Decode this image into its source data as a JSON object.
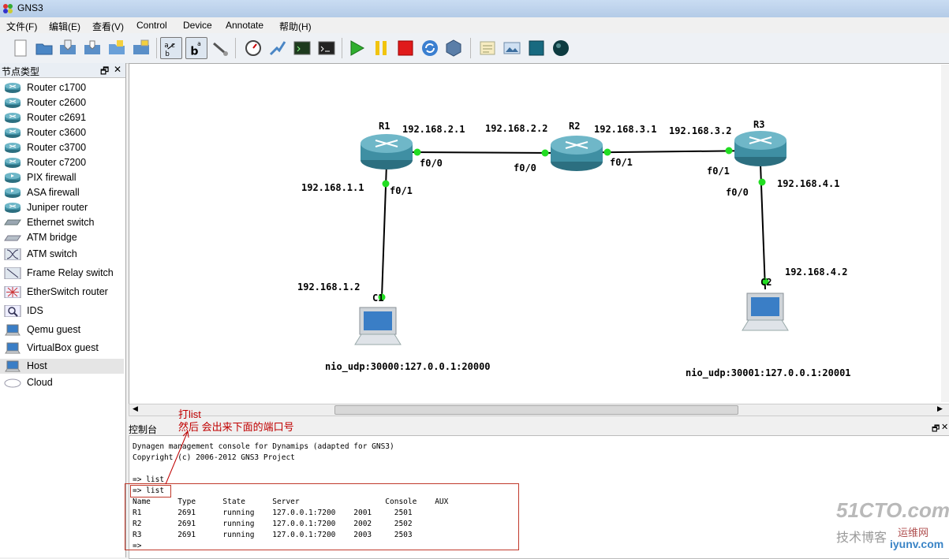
{
  "window": {
    "title": "GNS3"
  },
  "menu": [
    "文件(F)",
    "编辑(E)",
    "查看(V)",
    "Control",
    "Device",
    "Annotate",
    "帮助(H)"
  ],
  "dock": {
    "title": "节点类型",
    "float_icon": "restore-icon",
    "close_icon": "close-icon",
    "nodes": [
      {
        "label": "Router c1700",
        "icon": "router-icon"
      },
      {
        "label": "Router c2600",
        "icon": "router-icon"
      },
      {
        "label": "Router c2691",
        "icon": "router-icon"
      },
      {
        "label": "Router c3600",
        "icon": "router-icon"
      },
      {
        "label": "Router c3700",
        "icon": "router-icon"
      },
      {
        "label": "Router c7200",
        "icon": "router-icon"
      },
      {
        "label": "PIX firewall",
        "icon": "firewall-icon"
      },
      {
        "label": "ASA firewall",
        "icon": "firewall-icon"
      },
      {
        "label": "Juniper router",
        "icon": "router-icon"
      },
      {
        "label": "Ethernet switch",
        "icon": "switch-icon"
      },
      {
        "label": "ATM bridge",
        "icon": "bridge-icon"
      },
      {
        "label": "ATM switch",
        "icon": "atm-switch-icon"
      },
      {
        "label": "Frame Relay switch",
        "icon": "frame-relay-icon"
      },
      {
        "label": "EtherSwitch router",
        "icon": "etherswitch-icon"
      },
      {
        "label": "IDS",
        "icon": "ids-icon"
      },
      {
        "label": "Qemu guest",
        "icon": "computer-icon"
      },
      {
        "label": "VirtualBox guest",
        "icon": "computer-icon"
      },
      {
        "label": "Host",
        "icon": "computer-icon",
        "selected": true
      },
      {
        "label": "Cloud",
        "icon": "cloud-icon"
      }
    ]
  },
  "topology": {
    "devices": {
      "r1": {
        "name": "R1"
      },
      "r2": {
        "name": "R2"
      },
      "r3": {
        "name": "R3"
      },
      "c1": {
        "name": "C1"
      },
      "c2": {
        "name": "C2"
      }
    },
    "labels": {
      "r1_ip_r2": "192.168.2.1",
      "r2_ip_r1": "192.168.2.2",
      "r2_ip_r3": "192.168.3.1",
      "r3_ip_r2": "192.168.3.2",
      "r1_f00": "f0/0",
      "r2_f00": "f0/0",
      "r2_f01": "f0/1",
      "r3_f01": "f0/1",
      "r1_ip_c1": "192.168.1.1",
      "r1_f01": "f0/1",
      "c1_ip": "192.168.1.2",
      "r3_f00": "f0/0",
      "r3_ip_c2": "192.168.4.1",
      "c2_ip": "192.168.4.2",
      "c1_nio": "nio_udp:30000:127.0.0.1:20000",
      "c2_nio": "nio_udp:30001:127.0.0.1:20001"
    },
    "link_color": "#000000",
    "port_color": "#22dd22"
  },
  "console": {
    "title": "控制台",
    "lines": [
      "Dynagen management console for Dynamips (adapted for GNS3)",
      "Copyright (c) 2006-2012 GNS3 Project",
      "",
      "=> list",
      "=> list"
    ],
    "table": {
      "header": "Name      Type      State      Server                   Console    AUX",
      "rows": [
        "R1        2691      running    127.0.0.1:7200    2001     2501",
        "R2        2691      running    127.0.0.1:7200    2002     2502",
        "R3        2691      running    127.0.0.1:7200    2003     2503"
      ],
      "prompt": "=>"
    }
  },
  "annotations": {
    "line1": "打list",
    "line2": "然后 会出来下面的端口号",
    "color": "#c00000"
  },
  "watermark": {
    "brand": "51CTO.com",
    "sub": "技术博客",
    "sub2": "运维网",
    "site": "iyunv.com"
  }
}
